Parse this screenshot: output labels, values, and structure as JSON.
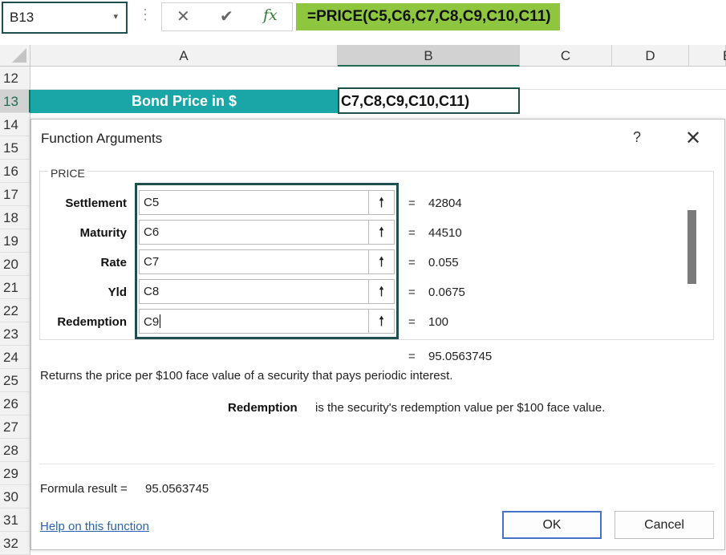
{
  "formula_bar": {
    "name_box": "B13",
    "name_box_arrow": "▾",
    "dots": "⋮",
    "cancel_glyph": "✕",
    "enter_glyph": "✔",
    "fx_glyph": "fx",
    "formula": "=PRICE(C5,C6,C7,C8,C9,C10,C11)"
  },
  "grid": {
    "columns": [
      "A",
      "B",
      "C",
      "D",
      "E"
    ],
    "rows": [
      "12",
      "13",
      "14",
      "15",
      "16",
      "17",
      "18",
      "19",
      "20",
      "21",
      "22",
      "23",
      "24",
      "25",
      "26",
      "27",
      "28",
      "29",
      "30",
      "31",
      "32"
    ],
    "selected_row": "13",
    "selected_column": "B",
    "a13": "Bond Price in $",
    "b13": "C7,C8,C9,C10,C11)",
    "colors": {
      "header_fill": "#1aa6a6",
      "selection_border": "#1f4e4e",
      "formula_highlight": "#8fc640"
    }
  },
  "dialog": {
    "title": "Function Arguments",
    "help_glyph": "?",
    "close_glyph": "✕",
    "function_name": "PRICE",
    "args": [
      {
        "label": "Settlement",
        "value": "C5",
        "result": "42804"
      },
      {
        "label": "Maturity",
        "value": "C6",
        "result": "44510"
      },
      {
        "label": "Rate",
        "value": "C7",
        "result": "0.055"
      },
      {
        "label": "Yld",
        "value": "C8",
        "result": "0.0675"
      },
      {
        "label": "Redemption",
        "value": "C9",
        "result": "100"
      }
    ],
    "collapse_glyph": "🠕",
    "equals": "=",
    "overall_result": "95.0563745",
    "description": "Returns the price per $100 face value of a security that pays periodic interest.",
    "arg_help_name": "Redemption",
    "arg_help_text": "is the security's redemption value per $100 face value.",
    "formula_result_label": "Formula result =",
    "formula_result_value": "95.0563745",
    "help_link": "Help on this function",
    "ok_label": "OK",
    "cancel_label": "Cancel"
  }
}
